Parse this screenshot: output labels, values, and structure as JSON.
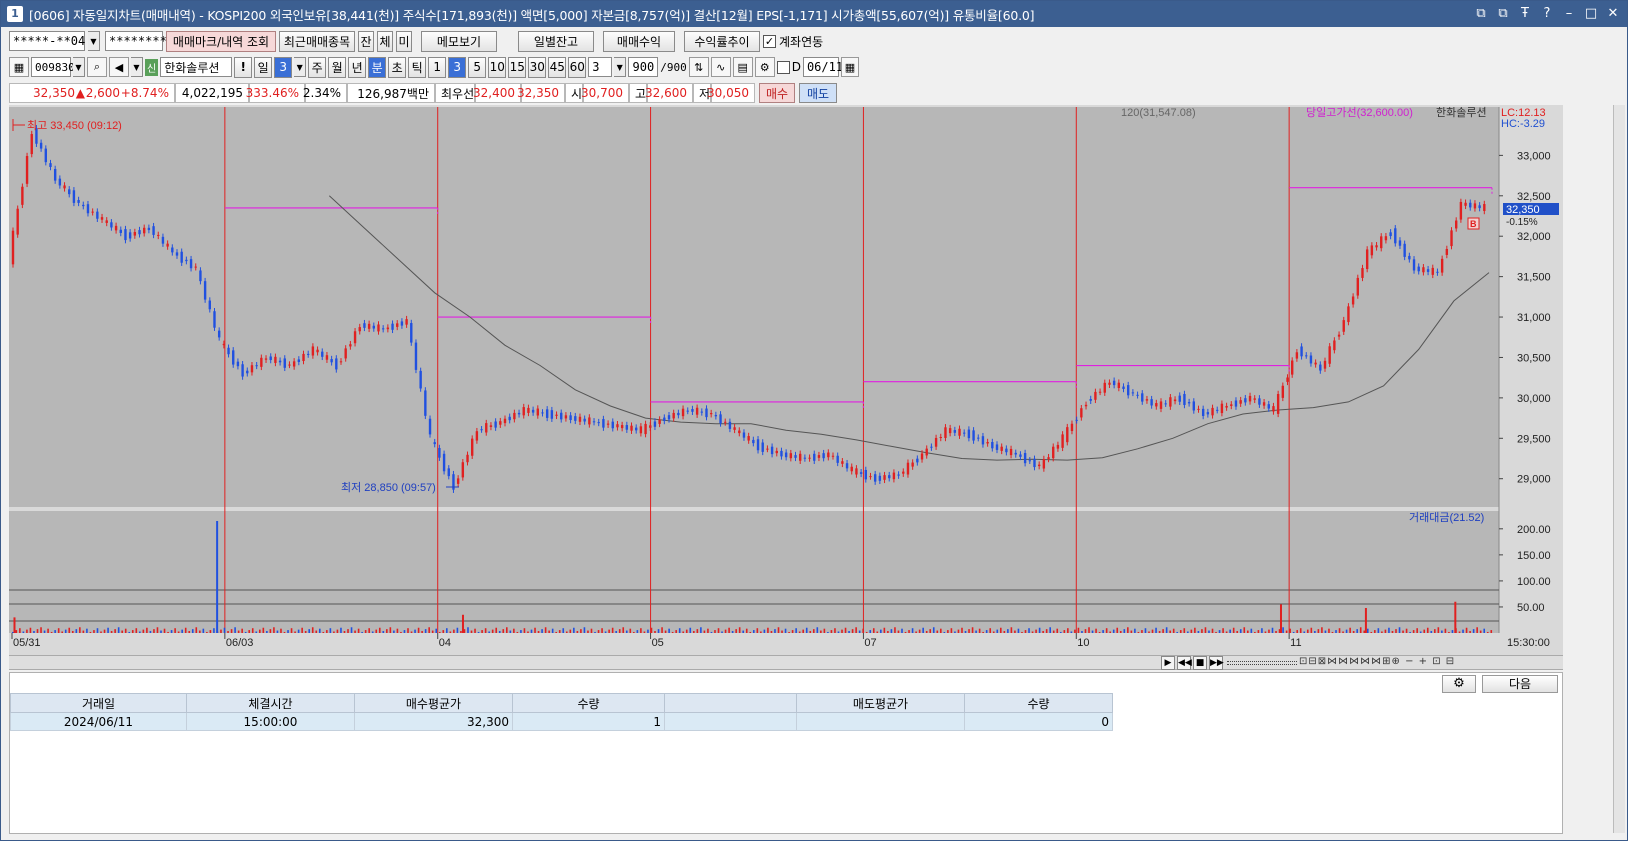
{
  "window": {
    "title": "[0606] 자동일지차트(매매내역) - KOSPI200 외국인보유[38,441(천)] 주식수[171,893(천)] 액면[5,000] 자본금[8,757(억)] 결산[12월] EPS[-1,171] 시가총액[55,607(억)] 유통비율[60.0]",
    "icon": "1",
    "buttons": [
      "⧉",
      "⧉",
      "Ŧ",
      "?",
      "–",
      "□",
      "✕"
    ]
  },
  "toolbar1": {
    "account": "*****-**04",
    "password": "********",
    "btn_trade_mark": "매매마크/내역 조회",
    "btn_recent": "최근매매종목",
    "btn_jan": "잔",
    "btn_che": "체",
    "btn_mi": "미",
    "btn_memo": "메모보기",
    "btn_daily": "일별잔고",
    "btn_profit": "매매수익",
    "btn_yield": "수익률추이",
    "link_label": "계좌연동",
    "link_checked": true
  },
  "toolbar2": {
    "code": "009830",
    "stock_tag": "신",
    "stock_name": "한화솔루션",
    "warn": "!",
    "day": "일",
    "day_num": "3",
    "week": "주",
    "month": "월",
    "year": "년",
    "minute": "분",
    "second": "초",
    "tick": "틱",
    "periods": [
      "1",
      "3",
      "5",
      "10",
      "15",
      "30",
      "45",
      "60"
    ],
    "selected_period": "3",
    "interval": "3",
    "count": "900",
    "count_total": "/900",
    "d_label": "D",
    "date": "06/11"
  },
  "quote": {
    "price": "32,350",
    "arrow": "▲",
    "change": "2,600",
    "change_pct": "+8.74%",
    "volume": "4,022,195",
    "vol_ratio": "333.46%",
    "turnover": "2.34%",
    "amount": "126,987백만",
    "best_label": "최우선",
    "best_ask": "32,400",
    "best_bid": "32,350",
    "open_label": "시",
    "open": "30,700",
    "high_label": "고",
    "high": "32,600",
    "low_label": "저",
    "low": "30,050",
    "buy_btn": "매수",
    "sell_btn": "매도"
  },
  "chart_data": {
    "type": "line",
    "title": "",
    "header_ma": "120(31,547.08)",
    "header_line": "당일고가선(32,600.00)",
    "header_name": "한화솔루션",
    "lc": "LC:12.13",
    "hc": "HC:-3.29",
    "high_label": "최고 33,450 (09:12)",
    "low_label": "최저 28,850 (09:57)",
    "price_ticks": [
      "33,000",
      "32,500",
      "32,000",
      "31,500",
      "31,000",
      "30,500",
      "30,000",
      "29,500",
      "29,000"
    ],
    "price_range": [
      28650,
      33450
    ],
    "last_price": "32,350",
    "last_pct": "-0.15%",
    "buy_marker": "B",
    "vol_label": "거래대금(21.52)",
    "vol_ticks": [
      "200.00",
      "150.00",
      "100.00",
      "50.00"
    ],
    "vol_range": [
      0,
      215
    ],
    "time_label": "15:30:00",
    "date_labels": [
      "05/31",
      "06/03",
      "04",
      "05",
      "07",
      "10",
      "11"
    ],
    "day_highs": [
      33450,
      32600
    ],
    "prev_high_lines": [
      {
        "from": 1,
        "to": 2,
        "value": 32350
      },
      {
        "from": 2,
        "to": 3,
        "value": 31000
      },
      {
        "from": 3,
        "to": 4,
        "value": 29950
      },
      {
        "from": 4,
        "to": 5,
        "value": 30200
      },
      {
        "from": 5,
        "to": 6,
        "value": 30400
      },
      {
        "from": 6,
        "to": 7,
        "value": 32600
      }
    ],
    "series": [
      {
        "name": "가격",
        "values": [
          31700,
          33300,
          32700,
          32400,
          32200,
          32000,
          32100,
          31800,
          31600,
          30700,
          30300,
          30500,
          30400,
          30600,
          30400,
          30900,
          30850,
          30950,
          29500,
          28900,
          29600,
          29700,
          29850,
          29800,
          29750,
          29700,
          29650,
          29600,
          29750,
          29850,
          29800,
          29600,
          29400,
          29300,
          29250,
          29300,
          29100,
          29000,
          29050,
          29300,
          29600,
          29550,
          29400,
          29300,
          29150,
          29500,
          29950,
          30200,
          30050,
          29900,
          30000,
          29800,
          29900,
          30000,
          29850,
          30600,
          30350,
          30950,
          31800,
          32050,
          31600,
          31550,
          32400,
          32350
        ]
      },
      {
        "name": "120",
        "values": [
          null,
          null,
          null,
          null,
          null,
          null,
          null,
          null,
          null,
          32500,
          32100,
          31700,
          31300,
          31000,
          30650,
          30400,
          30100,
          29900,
          29750,
          29700,
          29680,
          29680,
          29600,
          29550,
          29480,
          29400,
          29320,
          29250,
          29230,
          29240,
          29230,
          29260,
          29370,
          29500,
          29680,
          29800,
          29850,
          29880,
          29950,
          30150,
          30600,
          31200,
          31550
        ]
      }
    ],
    "volume_spikes": [
      {
        "pos": 0.137,
        "value": 215
      },
      {
        "pos": 0.001,
        "value": 30
      },
      {
        "pos": 0.302,
        "value": 35
      },
      {
        "pos": 0.851,
        "value": 55
      },
      {
        "pos": 0.908,
        "value": 48
      },
      {
        "pos": 0.968,
        "value": 60
      }
    ]
  },
  "navbar": {
    "icons": [
      "▶",
      "◀◀",
      "■",
      "▶▶"
    ]
  },
  "bottom": {
    "next_btn": "다음",
    "gear_icon": "⚙",
    "headers": [
      "거래일",
      "체결시간",
      "매수평균가",
      "수량",
      "",
      "매도평균가",
      "수량"
    ],
    "rows": [
      [
        "2024/06/11",
        "15:00:00",
        "32,300",
        "1",
        "",
        "",
        "0"
      ]
    ]
  }
}
